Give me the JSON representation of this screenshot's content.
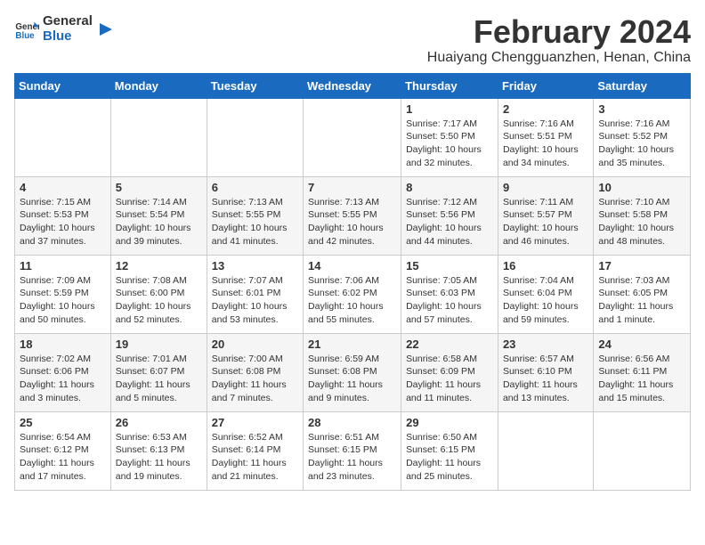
{
  "logo": {
    "text_general": "General",
    "text_blue": "Blue"
  },
  "title": "February 2024",
  "subtitle": "Huaiyang Chengguanzhen, Henan, China",
  "days_of_week": [
    "Sunday",
    "Monday",
    "Tuesday",
    "Wednesday",
    "Thursday",
    "Friday",
    "Saturday"
  ],
  "weeks": [
    [
      {
        "day": "",
        "info": ""
      },
      {
        "day": "",
        "info": ""
      },
      {
        "day": "",
        "info": ""
      },
      {
        "day": "",
        "info": ""
      },
      {
        "day": "1",
        "info": "Sunrise: 7:17 AM\nSunset: 5:50 PM\nDaylight: 10 hours\nand 32 minutes."
      },
      {
        "day": "2",
        "info": "Sunrise: 7:16 AM\nSunset: 5:51 PM\nDaylight: 10 hours\nand 34 minutes."
      },
      {
        "day": "3",
        "info": "Sunrise: 7:16 AM\nSunset: 5:52 PM\nDaylight: 10 hours\nand 35 minutes."
      }
    ],
    [
      {
        "day": "4",
        "info": "Sunrise: 7:15 AM\nSunset: 5:53 PM\nDaylight: 10 hours\nand 37 minutes."
      },
      {
        "day": "5",
        "info": "Sunrise: 7:14 AM\nSunset: 5:54 PM\nDaylight: 10 hours\nand 39 minutes."
      },
      {
        "day": "6",
        "info": "Sunrise: 7:13 AM\nSunset: 5:55 PM\nDaylight: 10 hours\nand 41 minutes."
      },
      {
        "day": "7",
        "info": "Sunrise: 7:13 AM\nSunset: 5:55 PM\nDaylight: 10 hours\nand 42 minutes."
      },
      {
        "day": "8",
        "info": "Sunrise: 7:12 AM\nSunset: 5:56 PM\nDaylight: 10 hours\nand 44 minutes."
      },
      {
        "day": "9",
        "info": "Sunrise: 7:11 AM\nSunset: 5:57 PM\nDaylight: 10 hours\nand 46 minutes."
      },
      {
        "day": "10",
        "info": "Sunrise: 7:10 AM\nSunset: 5:58 PM\nDaylight: 10 hours\nand 48 minutes."
      }
    ],
    [
      {
        "day": "11",
        "info": "Sunrise: 7:09 AM\nSunset: 5:59 PM\nDaylight: 10 hours\nand 50 minutes."
      },
      {
        "day": "12",
        "info": "Sunrise: 7:08 AM\nSunset: 6:00 PM\nDaylight: 10 hours\nand 52 minutes."
      },
      {
        "day": "13",
        "info": "Sunrise: 7:07 AM\nSunset: 6:01 PM\nDaylight: 10 hours\nand 53 minutes."
      },
      {
        "day": "14",
        "info": "Sunrise: 7:06 AM\nSunset: 6:02 PM\nDaylight: 10 hours\nand 55 minutes."
      },
      {
        "day": "15",
        "info": "Sunrise: 7:05 AM\nSunset: 6:03 PM\nDaylight: 10 hours\nand 57 minutes."
      },
      {
        "day": "16",
        "info": "Sunrise: 7:04 AM\nSunset: 6:04 PM\nDaylight: 10 hours\nand 59 minutes."
      },
      {
        "day": "17",
        "info": "Sunrise: 7:03 AM\nSunset: 6:05 PM\nDaylight: 11 hours\nand 1 minute."
      }
    ],
    [
      {
        "day": "18",
        "info": "Sunrise: 7:02 AM\nSunset: 6:06 PM\nDaylight: 11 hours\nand 3 minutes."
      },
      {
        "day": "19",
        "info": "Sunrise: 7:01 AM\nSunset: 6:07 PM\nDaylight: 11 hours\nand 5 minutes."
      },
      {
        "day": "20",
        "info": "Sunrise: 7:00 AM\nSunset: 6:08 PM\nDaylight: 11 hours\nand 7 minutes."
      },
      {
        "day": "21",
        "info": "Sunrise: 6:59 AM\nSunset: 6:08 PM\nDaylight: 11 hours\nand 9 minutes."
      },
      {
        "day": "22",
        "info": "Sunrise: 6:58 AM\nSunset: 6:09 PM\nDaylight: 11 hours\nand 11 minutes."
      },
      {
        "day": "23",
        "info": "Sunrise: 6:57 AM\nSunset: 6:10 PM\nDaylight: 11 hours\nand 13 minutes."
      },
      {
        "day": "24",
        "info": "Sunrise: 6:56 AM\nSunset: 6:11 PM\nDaylight: 11 hours\nand 15 minutes."
      }
    ],
    [
      {
        "day": "25",
        "info": "Sunrise: 6:54 AM\nSunset: 6:12 PM\nDaylight: 11 hours\nand 17 minutes."
      },
      {
        "day": "26",
        "info": "Sunrise: 6:53 AM\nSunset: 6:13 PM\nDaylight: 11 hours\nand 19 minutes."
      },
      {
        "day": "27",
        "info": "Sunrise: 6:52 AM\nSunset: 6:14 PM\nDaylight: 11 hours\nand 21 minutes."
      },
      {
        "day": "28",
        "info": "Sunrise: 6:51 AM\nSunset: 6:15 PM\nDaylight: 11 hours\nand 23 minutes."
      },
      {
        "day": "29",
        "info": "Sunrise: 6:50 AM\nSunset: 6:15 PM\nDaylight: 11 hours\nand 25 minutes."
      },
      {
        "day": "",
        "info": ""
      },
      {
        "day": "",
        "info": ""
      }
    ]
  ]
}
